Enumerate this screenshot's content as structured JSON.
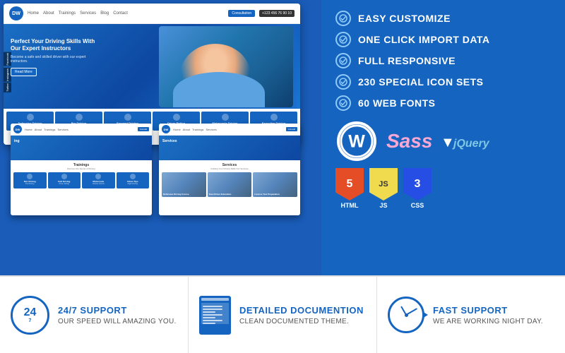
{
  "features": [
    {
      "id": "easy-customize",
      "label": "EASY CUSTOMIZE"
    },
    {
      "id": "one-click-import",
      "label": "ONE CLICK IMPORT DATA"
    },
    {
      "id": "full-responsive",
      "label": "FULL RESPONSIVE"
    },
    {
      "id": "icon-sets",
      "label": "230 SPECIAL ICON SETS"
    },
    {
      "id": "web-fonts",
      "label": "60 WEB FONTS"
    }
  ],
  "tech": {
    "wordpress_char": "W",
    "sass_label": "Sass",
    "jquery_label": "jQuery",
    "html5_label": "HTML",
    "html5_num": "5",
    "js_label": "JS",
    "js_num": "JS",
    "css3_label": "CSS",
    "css3_num": "3"
  },
  "website_mockup": {
    "logo_text": "DW",
    "nav_items": [
      "Home",
      "About",
      "Trainings",
      "Services",
      "Blog",
      "Contact"
    ],
    "consult_btn": "Consultation",
    "phone": "+123 456 76 90 10",
    "hero_title": "Perfect Your Driving Skills With Our Expert Instructors",
    "hero_sub": "Become a safe and skilled driver with our expert instructors.",
    "read_more": "Read More",
    "social": [
      "Facebook",
      "Instagram",
      "Twitter"
    ],
    "cards": [
      {
        "title": "Defensive Driving",
        "desc": "Driving skills that'll ready for danger and careful"
      },
      {
        "title": "Pro Driving",
        "desc": "Driving with vision and responsibility"
      },
      {
        "title": "Forward Driving",
        "desc": "Don't go beyond basic driving skills"
      },
      {
        "title": "Driver Rating",
        "desc": "Evaluation of driver performance"
      },
      {
        "title": "Motorcycle Driving",
        "desc": "Learn the art of safe driving"
      },
      {
        "title": "Executive Driving",
        "desc": "Perfect copy of high-quality"
      }
    ],
    "trainings_title": "Trainings",
    "discover_title": "Discover the Secret of Driving",
    "services_title": "Services",
    "crafting_title": "Crafting Your Driving Skills Our Services",
    "service_items": [
      "Defensive Driving Course",
      "Teen Driver Education",
      "License Test Preparation"
    ]
  },
  "bottom_panels": [
    {
      "id": "support-247",
      "icon_type": "24-circle",
      "title": "24/7 SUPPORT",
      "description": "OUR SPEED WILL AMAZING YOU."
    },
    {
      "id": "detailed-doc",
      "icon_type": "doc",
      "title": "DETAILED DOCUMENTION",
      "description": "CLEAN DOCUMENTED THEME."
    },
    {
      "id": "fast-support",
      "icon_type": "clock",
      "title": "FAST SUPPORT",
      "description": "WE ARE WORKING NIGHT DAY."
    }
  ]
}
